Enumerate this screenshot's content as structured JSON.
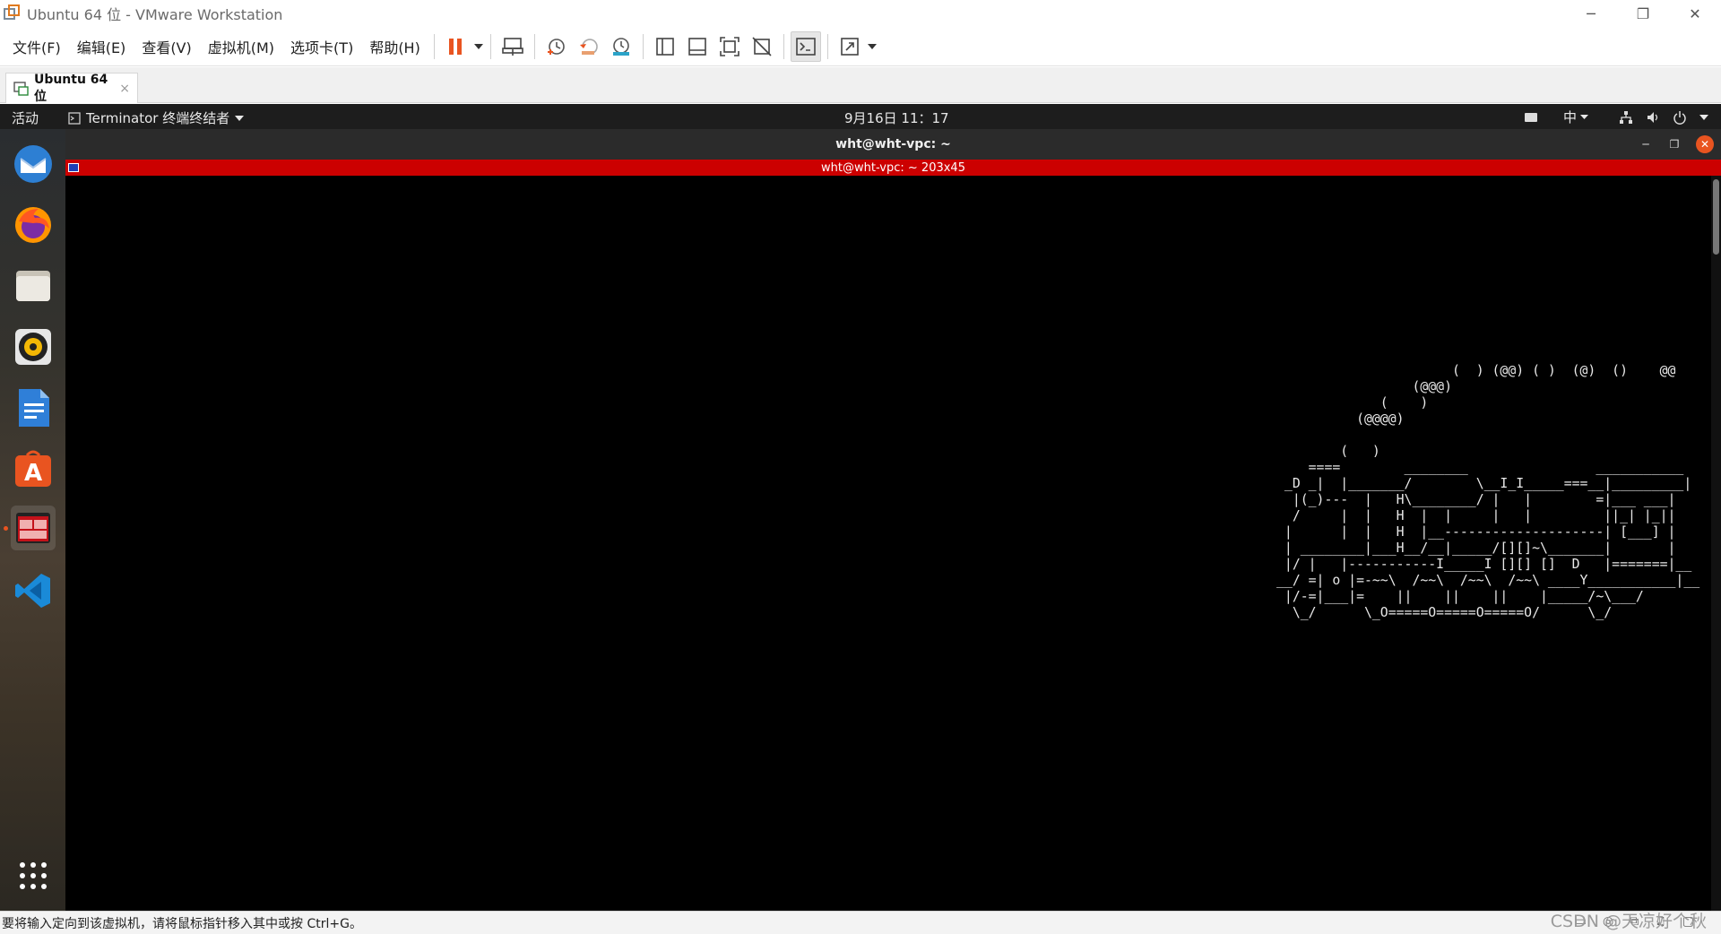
{
  "window": {
    "title": "Ubuntu 64 位 - VMware Workstation",
    "minimize": "─",
    "maximize": "❐",
    "close": "✕"
  },
  "menubar": {
    "items": [
      "文件(F)",
      "编辑(E)",
      "查看(V)",
      "虚拟机(M)",
      "选项卡(T)",
      "帮助(H)"
    ]
  },
  "toolbar": {
    "icons": [
      "pause-icon",
      "send-ctrl-alt-del-icon",
      "snapshot-take-icon",
      "snapshot-revert-icon",
      "snapshot-manager-icon",
      "library-icon",
      "thumbnail-bar-icon",
      "fullscreen-icon",
      "unity-icon",
      "console-view-icon",
      "stretch-icon"
    ],
    "accent": "#e95420"
  },
  "tab": {
    "label": "Ubuntu 64 位",
    "close": "×"
  },
  "gnome": {
    "activities": "活动",
    "app_menu": "Terminator 终端终结者",
    "clock": "9月16日  11：17",
    "input_method": "中"
  },
  "dock": {
    "apps": [
      "thunderbird-icon",
      "firefox-icon",
      "files-icon",
      "rhythmbox-icon",
      "libreoffice-writer-icon",
      "ubuntu-software-icon",
      "terminator-icon",
      "vscode-icon",
      "show-applications-icon"
    ],
    "running": "terminator-icon"
  },
  "terminal": {
    "window_title": "wht@wht-vpc: ~",
    "inner_title": "wht@wht-vpc: ~ 203x45",
    "title_bg": "#cc0000",
    "ascii_lines": [
      "                      (  ) (@@) ( )  (@)  ()    @@",
      "                 (@@@)",
      "             (    )",
      "          (@@@@)",
      "",
      "        (   )",
      "    ====        ________                ___________",
      " _D _|  |_______/        \\__I_I_____===__|_________|",
      "  |(_)---  |   H\\________/ |   |        =|___ ___|",
      "  /     |  |   H  |  |     |   |         ||_| |_||",
      " |      |  |   H  |__--------------------| [___] |",
      " | ________|___H__/__|_____/[][]~\\_______|       |",
      " |/ |   |-----------I_____I [][] []  D   |=======|__",
      "__/ =| o |=-~~\\  /~~\\  /~~\\  /~~\\ ____Y___________|__",
      " |/-=|___|=    ||    ||    ||    |_____/~\\___/",
      "  \\_/      \\_O=====O=====O=====O/      \\_/"
    ]
  },
  "statusbar": {
    "message": "要将输入定向到该虚拟机，请将鼠标指针移入其中或按 Ctrl+G。",
    "watermark": "CSDN @天凉好个秋"
  }
}
